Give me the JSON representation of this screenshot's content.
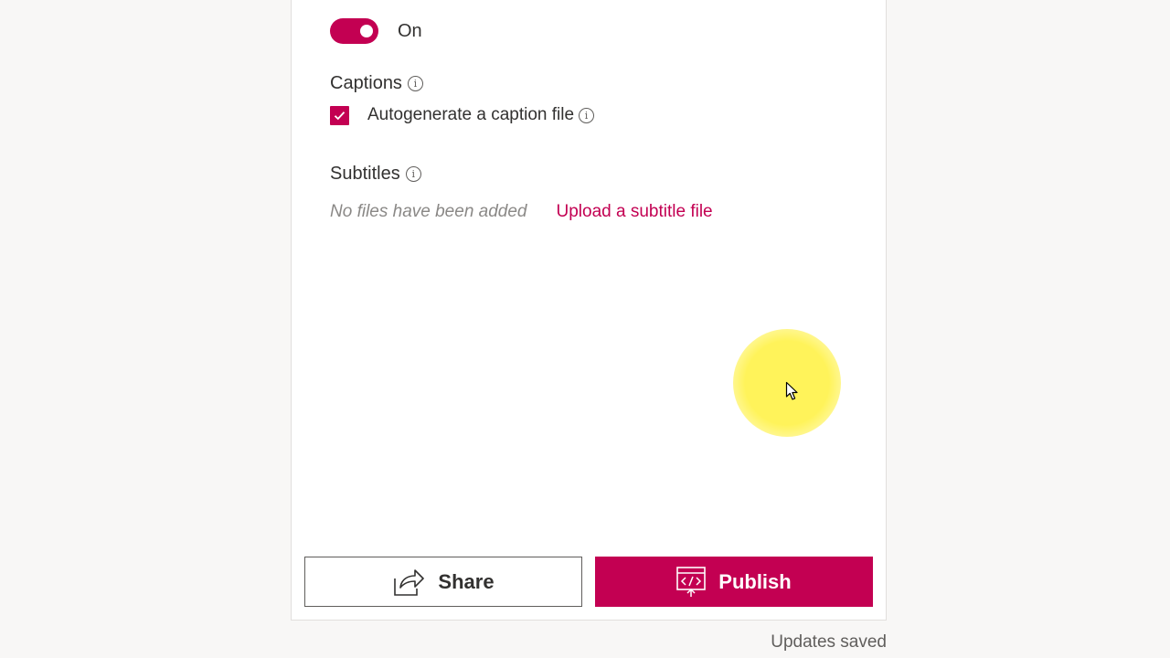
{
  "settings": {
    "toggle_label": "On",
    "toggle_on": true,
    "captions_title": "Captions",
    "autogenerate_label": "Autogenerate a caption file",
    "autogenerate_checked": true,
    "subtitles_title": "Subtitles",
    "subtitles_empty": "No files have been added",
    "upload_link": "Upload a subtitle file"
  },
  "actions": {
    "share_label": "Share",
    "publish_label": "Publish"
  },
  "status": {
    "text": "Updates saved"
  },
  "colors": {
    "accent": "#c30052",
    "background": "#f8f7f6",
    "panel": "#ffffff",
    "cursor_highlight": "#fff35a"
  },
  "icons": {
    "share": "share-icon",
    "publish": "publish-embed-icon",
    "info": "info-icon",
    "check": "check-icon",
    "cursor": "mouse-pointer-icon"
  }
}
